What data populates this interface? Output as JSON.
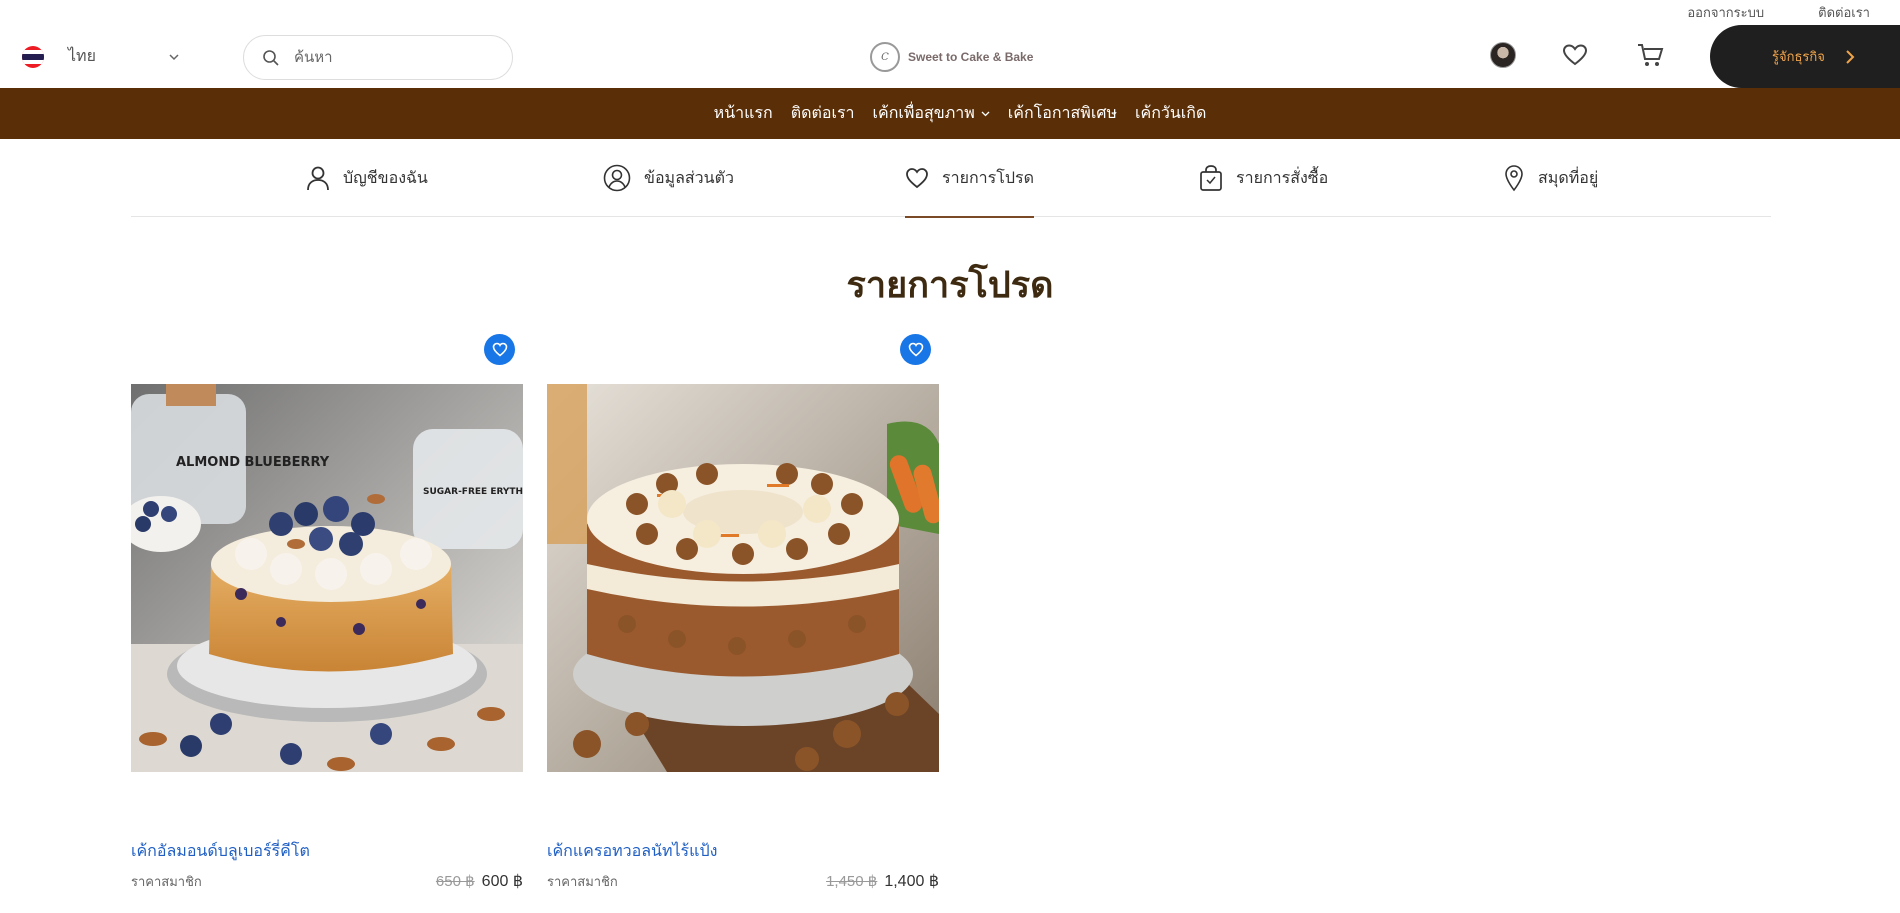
{
  "top_links": {
    "logout": "ออกจากระบบ",
    "contact": "ติดต่อเรา"
  },
  "header": {
    "language": "ไทย",
    "search_placeholder": "ค้นหา",
    "logo_text": "Sweet to Cake & Bake",
    "business_button": "รู้จักธุรกิจ"
  },
  "nav": {
    "items": [
      "หน้าแรก",
      "ติดต่อเรา",
      "เค้กเพื่อสุขภาพ",
      "เค้กโอกาสพิเศษ",
      "เค้กวันเกิด"
    ]
  },
  "account_tabs": [
    {
      "label": "บัญชีของฉัน",
      "icon": "user-icon"
    },
    {
      "label": "ข้อมูลส่วนตัว",
      "icon": "profile-icon"
    },
    {
      "label": "รายการโปรด",
      "icon": "heart-icon",
      "active": true
    },
    {
      "label": "รายการสั่งซื้อ",
      "icon": "shopping-bag-icon"
    },
    {
      "label": "สมุดที่อยู่",
      "icon": "location-pin-icon"
    }
  ],
  "page_title": "รายการโปรด",
  "products": [
    {
      "name": "เค้กอัลมอนด์บลูเบอร์รี่คีโต",
      "member_label": "ราคาสมาชิก",
      "old_price": "650 ฿",
      "price": "600 ฿",
      "image_text_1": "ALMOND BLUEBERRY",
      "image_text_2": "SUGAR-FREE ERYTHRITOL"
    },
    {
      "name": "เค้กแครอทวอลนัทไร้แป้ง",
      "member_label": "ราคาสมาชิก",
      "old_price": "1,450 ฿",
      "price": "1,400 ฿"
    }
  ],
  "colors": {
    "nav_bg": "#5a2e06",
    "fav_blue": "#1976e6",
    "link_blue": "#1f5fc4",
    "title_brown": "#3d2a10",
    "biz_text": "#f0a44a"
  }
}
